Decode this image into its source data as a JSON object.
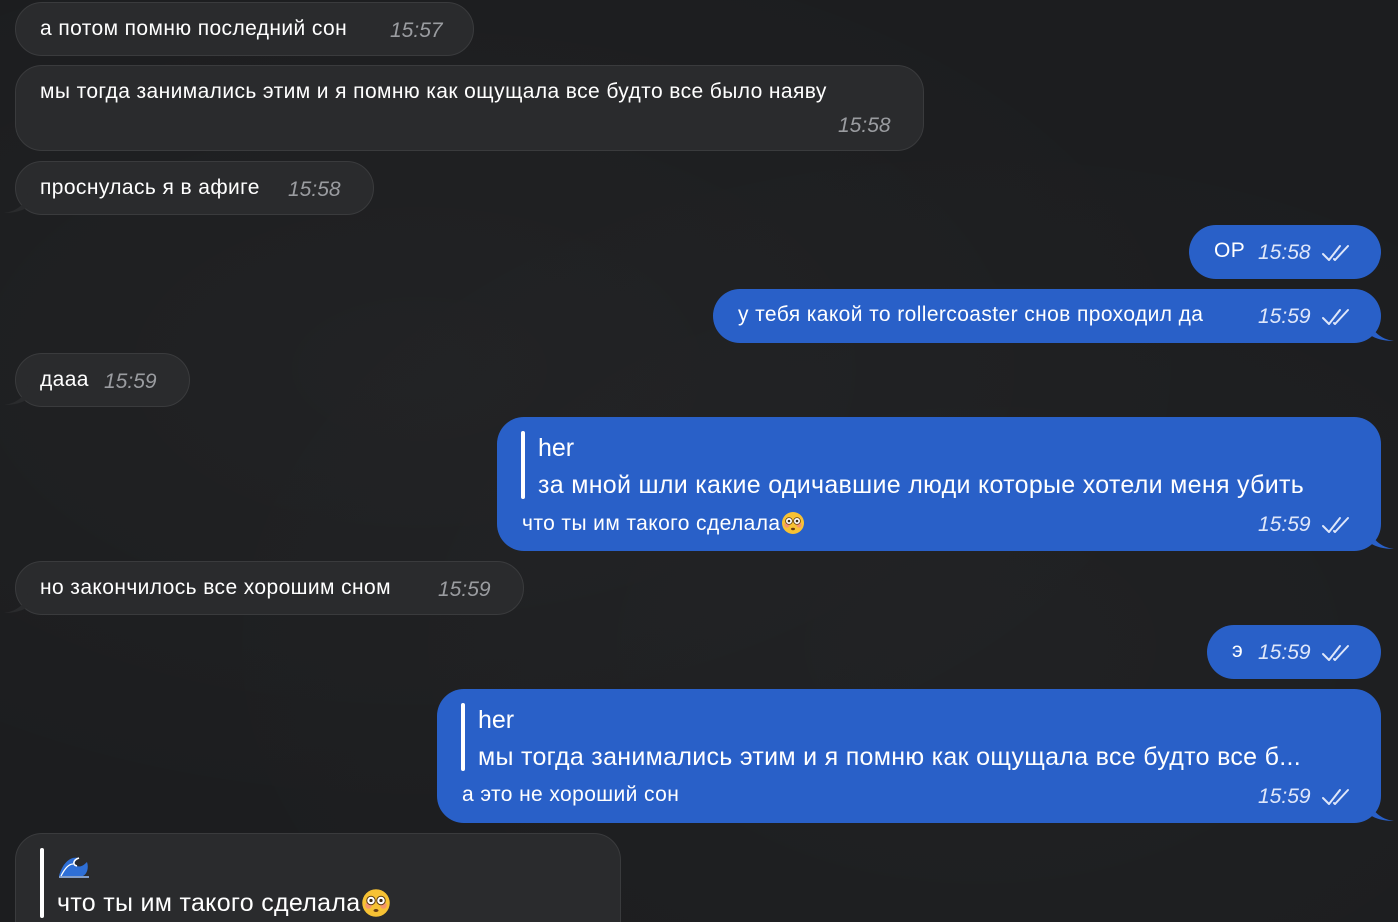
{
  "messages": [
    {
      "id": "m1",
      "dir": "in",
      "text": "а потом помню последний сон",
      "time": "15:57"
    },
    {
      "id": "m2",
      "dir": "in",
      "text": "мы тогда занимались этим и я помню как ощущала все будто все было наяву",
      "time": "15:58"
    },
    {
      "id": "m3",
      "dir": "in",
      "text": "проснулась я в афиге",
      "time": "15:58"
    },
    {
      "id": "m4",
      "dir": "out",
      "text": "ОР",
      "time": "15:58"
    },
    {
      "id": "m5",
      "dir": "out",
      "text": "у тебя какой то rollercoaster снов проходил да",
      "time": "15:59"
    },
    {
      "id": "m6",
      "dir": "in",
      "text": "дааа",
      "time": "15:59"
    },
    {
      "id": "m7",
      "dir": "out",
      "quote_name": "her",
      "quote_text": "за мной шли какие одичавшие люди которые хотели меня убить",
      "text": "что ты им такого сделала",
      "emoji": "flushed-face",
      "time": "15:59"
    },
    {
      "id": "m8",
      "dir": "in",
      "text": "но закончилось все хорошим сном",
      "time": "15:59"
    },
    {
      "id": "m9",
      "dir": "out",
      "text": "э",
      "time": "15:59"
    },
    {
      "id": "m10",
      "dir": "out",
      "quote_name": "her",
      "quote_text": "мы тогда занимались этим и я помню как ощущала все будто все б...",
      "text": "а это не хороший сон",
      "time": "15:59"
    },
    {
      "id": "m11",
      "dir": "in",
      "quote_emoji": "wave",
      "quote_text": "что ты им такого сделала",
      "quote_text_emoji": "flushed-face"
    }
  ],
  "colors": {
    "background": "#1c1d1f",
    "incoming_bubble": "#2a2b2d",
    "outgoing_bubble": "#2960c8",
    "incoming_time": "#9a9ca0",
    "outgoing_time": "#dfe7fa"
  },
  "icons": {
    "read_receipt": "double-check-icon",
    "reaction_emoji": "flushed-face-emoji",
    "wave_emoji": "water-wave-emoji"
  }
}
